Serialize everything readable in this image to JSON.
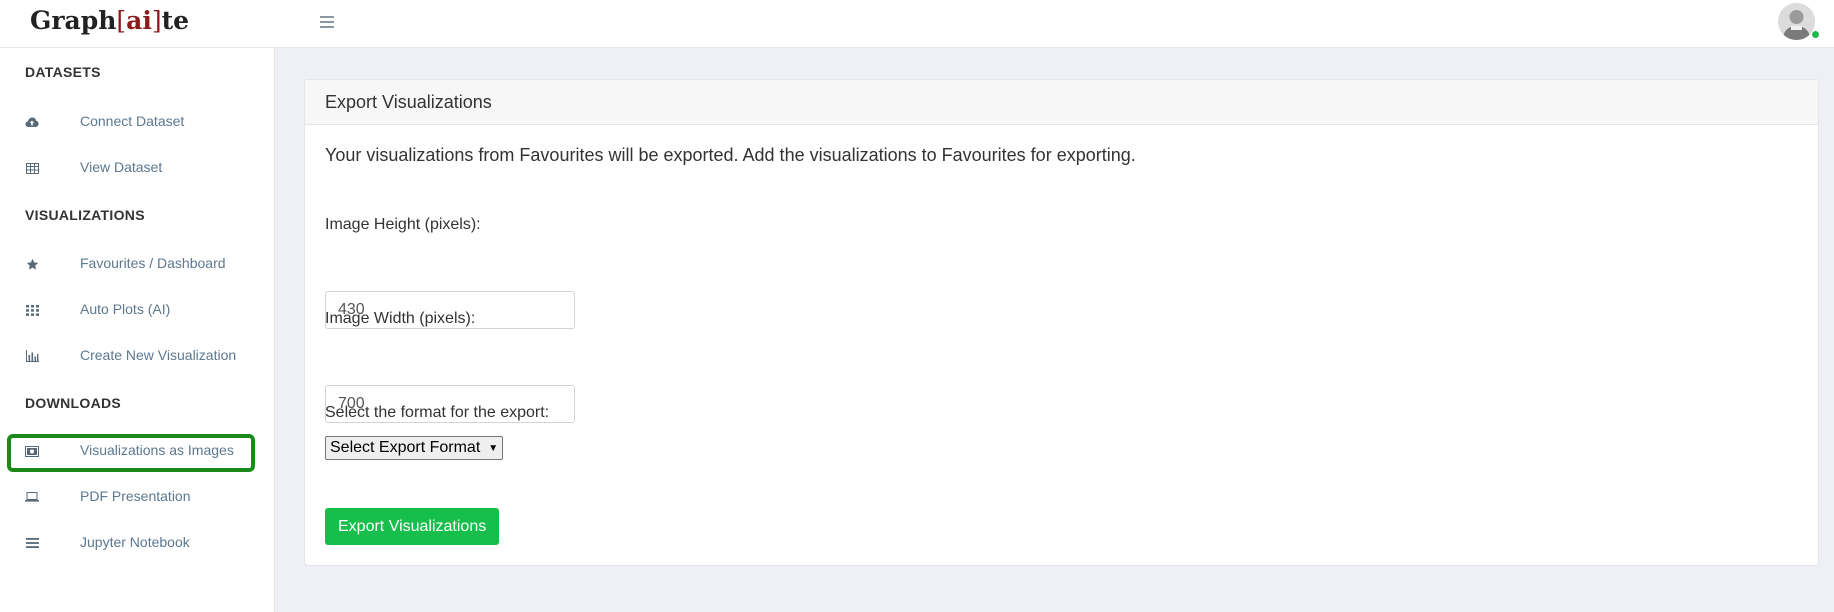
{
  "brand": {
    "prefix": "Graph",
    "open_bracket": "[",
    "middle": "ai",
    "close_bracket": "]",
    "suffix": "te"
  },
  "header": {
    "menu_icon": "hamburger-icon",
    "avatar_icon": "user-avatar-icon",
    "status_color": "#1fb84a"
  },
  "sidebar": {
    "sections": [
      {
        "title": "DATASETS",
        "items": [
          {
            "label": "Connect Dataset",
            "icon": "cloud-upload-icon"
          },
          {
            "label": "View Dataset",
            "icon": "table-icon"
          }
        ]
      },
      {
        "title": "VISUALIZATIONS",
        "items": [
          {
            "label": "Favourites / Dashboard",
            "icon": "star-icon"
          },
          {
            "label": "Auto Plots (AI)",
            "icon": "grid-icon"
          },
          {
            "label": "Create New Visualization",
            "icon": "bar-chart-icon"
          }
        ]
      },
      {
        "title": "DOWNLOADS",
        "items": [
          {
            "label": "Visualizations as Images",
            "icon": "image-icon",
            "highlighted": true
          },
          {
            "label": "PDF Presentation",
            "icon": "laptop-icon"
          },
          {
            "label": "Jupyter Notebook",
            "icon": "list-icon"
          }
        ]
      }
    ],
    "highlight_color": "#1a8a1a"
  },
  "card": {
    "title": "Export Visualizations",
    "description": "Your visualizations from Favourites will be exported. Add the visualizations to Favourites for exporting.",
    "height_label": "Image Height (pixels):",
    "height_value": "430",
    "width_label": "Image Width (pixels):",
    "width_value": "700",
    "format_label": "Select the format for the export:",
    "format_selected": "Select Export Format",
    "export_button": "Export Visualizations",
    "button_color": "#16bf4b"
  }
}
